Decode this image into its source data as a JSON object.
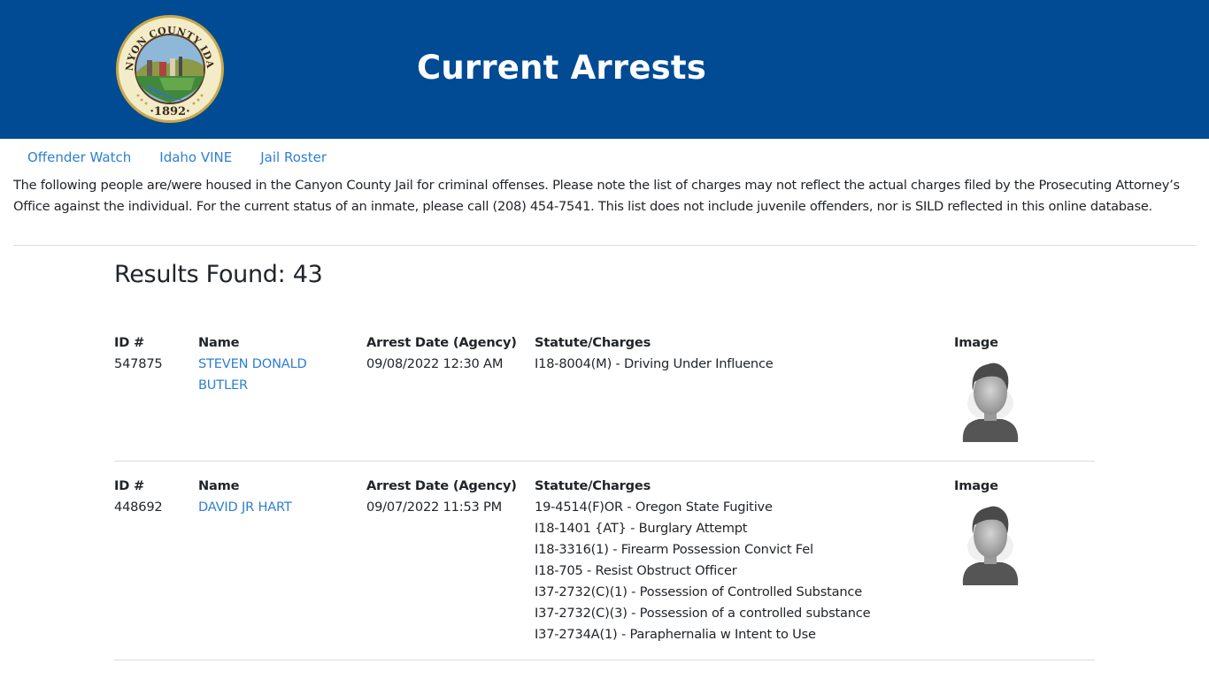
{
  "header": {
    "title": "Current Arrests",
    "seal": {
      "top_text": "CANYON COUNTY IDAHO",
      "year": "·1892·",
      "icon": "county-seal-icon"
    },
    "background_color": "#004b93"
  },
  "nav": {
    "links": [
      {
        "label": "Offender Watch"
      },
      {
        "label": "Idaho VINE"
      },
      {
        "label": "Jail Roster"
      }
    ],
    "link_color": "#2d7fd3"
  },
  "intro": {
    "text": "The following people are/were housed in the Canyon County Jail for criminal offenses. Please note the list of charges may not reflect the actual charges filed by the Prosecuting Attorney’s Office against the individual. For the current status of an inmate, please call (208) 454-7541. This list does not include juvenile offenders, nor is SILD reflected in this online database."
  },
  "results": {
    "heading": "Results Found: 43",
    "column_labels": {
      "id": "ID #",
      "name": "Name",
      "arrest_date": "Arrest Date (Agency)",
      "charges": "Statute/Charges",
      "image": "Image"
    },
    "records": [
      {
        "id": "547875",
        "name_line1": "STEVEN DONALD",
        "name_line2": "BUTLER",
        "arrest_date": "09/08/2022 12:30 AM",
        "charges": [
          "I18-8004(M) - Driving Under Influence"
        ],
        "image_icon": "person-placeholder-icon"
      },
      {
        "id": "448692",
        "name_line1": "DAVID JR HART",
        "name_line2": "",
        "arrest_date": "09/07/2022 11:53 PM",
        "charges": [
          "19-4514(F)OR - Oregon State Fugitive",
          "I18-1401 {AT} - Burglary Attempt",
          "I18-3316(1) - Firearm Possession Convict Fel",
          "I18-705 - Resist Obstruct Officer",
          "I37-2732(C)(1) - Possession of Controlled Substance",
          "I37-2732(C)(3) - Possession of a controlled substance",
          "I37-2734A(1) - Paraphernalia w Intent to Use"
        ],
        "image_icon": "person-placeholder-icon"
      }
    ]
  }
}
